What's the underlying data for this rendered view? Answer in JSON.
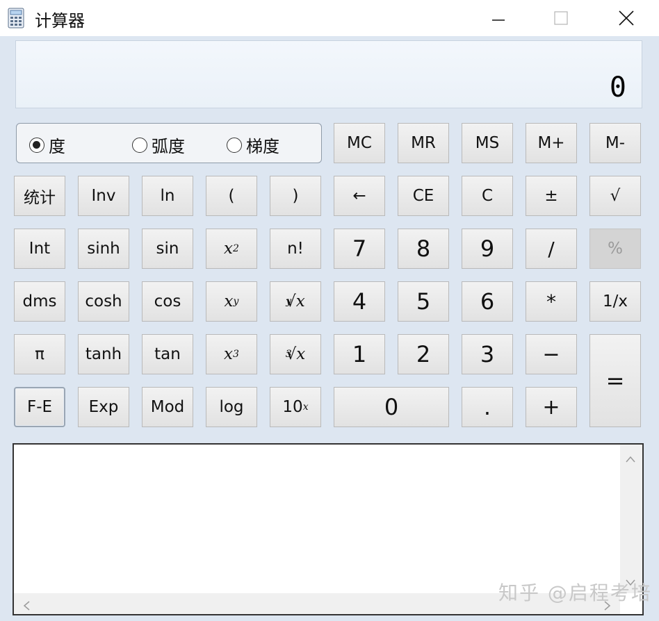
{
  "window": {
    "title": "计算器"
  },
  "display": {
    "value": "0"
  },
  "angle_mode": {
    "options": [
      {
        "label": "度",
        "checked": true
      },
      {
        "label": "弧度",
        "checked": false
      },
      {
        "label": "梯度",
        "checked": false
      }
    ]
  },
  "memory": {
    "mc": "MC",
    "mr": "MR",
    "ms": "MS",
    "mplus": "M+",
    "mminus": "M-"
  },
  "buttons": {
    "stat": "统计",
    "inv": "Inv",
    "ln": "ln",
    "lparen": "(",
    "rparen": ")",
    "backspace": "←",
    "ce": "CE",
    "c": "C",
    "negate": "±",
    "sqrt": "√",
    "int": "Int",
    "sinh": "sinh",
    "sin": "sin",
    "x_base": "x",
    "x2_exp": "2",
    "fact": "n!",
    "seven": "7",
    "eight": "8",
    "nine": "9",
    "divide": "/",
    "percent": "%",
    "dms": "dms",
    "cosh": "cosh",
    "cos": "cos",
    "xy_exp": "y",
    "yroot_index": "y",
    "root_sym": "√",
    "four": "4",
    "five": "5",
    "six": "6",
    "multiply": "*",
    "reciprocal": "1/x",
    "pi": "π",
    "tanh": "tanh",
    "tan": "tan",
    "x3_exp": "3",
    "cuberoot_index": "3",
    "one": "1",
    "two": "2",
    "three": "3",
    "minus": "−",
    "equals": "=",
    "fe": "F-E",
    "exp": "Exp",
    "mod": "Mod",
    "log": "log",
    "ten_base": "10",
    "ten_exp": "x",
    "zero": "0",
    "dot": ".",
    "plus": "+"
  },
  "watermark": "知乎 @启程考培",
  "icons": {
    "app": "calculator-icon",
    "minimize": "minimize-icon",
    "maximize": "maximize-icon",
    "close": "close-icon",
    "scroll_up": "chevron-up-icon",
    "scroll_down": "chevron-down-icon",
    "scroll_left": "chevron-left-icon",
    "scroll_right": "chevron-right-icon"
  }
}
